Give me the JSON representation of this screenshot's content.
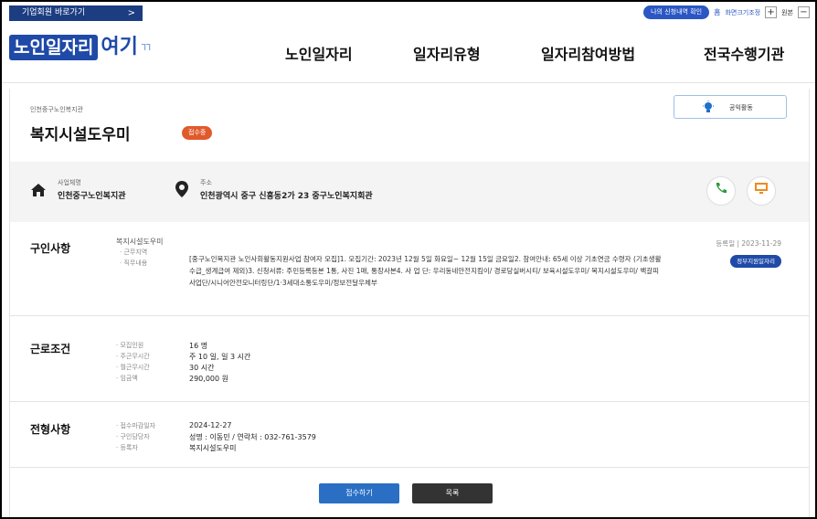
{
  "utility": {
    "corp_shortcut": "기업회원 바로가기",
    "arrow": ">",
    "my_apps": "나의 신청내역 확인",
    "home": "홈",
    "font_size": "화면크기조정",
    "plus": "+",
    "reset": "원본",
    "minus": "−"
  },
  "header": {
    "logo_part1": "노인일자리",
    "logo_part2": "여기",
    "logo_part3": "ㄲ",
    "nav": [
      "노인일자리",
      "일자리유형",
      "일자리참여방법",
      "전국수행기관"
    ]
  },
  "job": {
    "org_small": "인천중구노인복지관",
    "title": "복지시설도우미",
    "status_badge": "접수중",
    "category_button": "공익활동",
    "org_label": "사업체명",
    "org_name": "인천중구노인복지관",
    "address_label": "주소",
    "address": "인천광역시 중구 신흥동2가 23 중구노인복지회관"
  },
  "recruit": {
    "heading": "구인사항",
    "job_name": "복지시설도우미",
    "region_label": "· 근무지역",
    "duty_label": "· 직무내용",
    "description": "[중구노인복지관 노인사회활동지원사업 참여자 모집]1. 모집기간: 2023년 12월 5일 화요일~ 12월 15일 금요일2. 참여안내: 65세 이상 기초연금 수령자 (기초생활수급_생계급여 제외)3. 신청서류: 주민등록등본 1통, 사진 1매, 통장사본4. 사 업 단: 우리동네안전지킴이/ 경로당실버시티/ 보육시설도우미/ 복지시설도우미/ 백갈피사업단/시니어안전모니터링단/1·3세대소통도우미/정보전달우체부",
    "reg_label": "등록일",
    "reg_date": "2023-11-29",
    "gov_badge": "정부지원일자리"
  },
  "conditions": {
    "heading": "근로조건",
    "rows": [
      {
        "label": "· 모집인원",
        "value": "16 명"
      },
      {
        "label": "· 주근무시간",
        "value": "주 10 일, 일 3 시간"
      },
      {
        "label": "· 월근무시간",
        "value": "30 시간"
      },
      {
        "label": "· 임금액",
        "value": "290,000 원"
      }
    ]
  },
  "screening": {
    "heading": "전형사항",
    "rows": [
      {
        "label": "· 접수마감일자",
        "value": "2024-12-27"
      },
      {
        "label": "· 구인담당자",
        "value": "성명 : 이동민 / 연락처 : 032-761-3579"
      },
      {
        "label": "· 등록자",
        "value": "복지시설도우미"
      }
    ]
  },
  "actions": {
    "apply": "접수하기",
    "list": "목록"
  },
  "icons": {
    "home": "home-icon",
    "pin": "location-pin-icon",
    "phone": "phone-icon",
    "monitor": "monitor-icon",
    "bulb": "lightbulb-icon"
  },
  "colors": {
    "navy": "#1c3d82",
    "blue": "#2a57c4",
    "orange": "#e05a2b",
    "dark_button": "#333333"
  }
}
